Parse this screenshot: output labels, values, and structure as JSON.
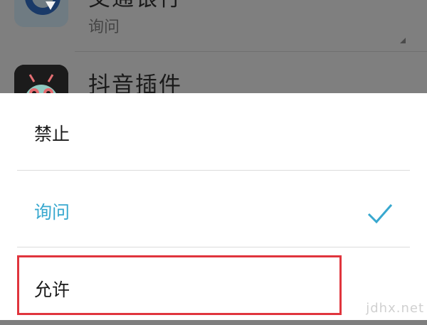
{
  "app_list": {
    "items": [
      {
        "name": "交通银行",
        "status": "询问",
        "icon": "bank-logo-icon"
      },
      {
        "name": "抖音插件",
        "status": "",
        "icon": "android-robot-icon"
      }
    ]
  },
  "dialog": {
    "options": [
      {
        "label": "禁止",
        "selected": false
      },
      {
        "label": "询问",
        "selected": true
      },
      {
        "label": "允许",
        "selected": false,
        "highlighted": true
      }
    ],
    "accent_color": "#38a8cf",
    "highlight_color": "#e0353d"
  },
  "watermark": "jdhx.net"
}
